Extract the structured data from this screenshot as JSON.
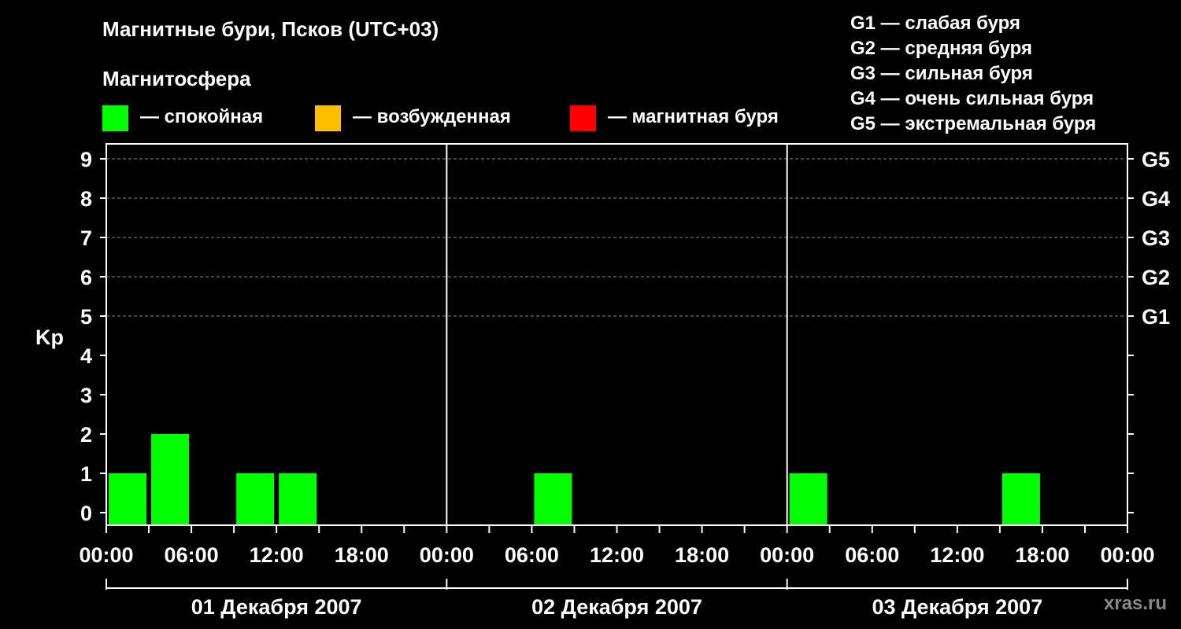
{
  "title": "Магнитные бури, Псков (UTC+03)",
  "subtitle": "Магнитосфера",
  "legend": [
    {
      "label": "— спокойная",
      "color": "#00ff00"
    },
    {
      "label": "— возбужденная",
      "color": "#ffbf00"
    },
    {
      "label": "— магнитная буря",
      "color": "#ff0000"
    }
  ],
  "g_legend": [
    "G1 — слабая буря",
    "G2 — средняя буря",
    "G3 — сильная буря",
    "G4 — очень сильная буря",
    "G5 — экстремальная буря"
  ],
  "watermark": "xras.ru",
  "chart_data": {
    "type": "bar",
    "ylabel": "Kp",
    "ylim": [
      0,
      9
    ],
    "yticks": [
      "0",
      "1",
      "2",
      "3",
      "4",
      "5",
      "6",
      "7",
      "8",
      "9"
    ],
    "right_labels": [
      {
        "kp": 5,
        "label": "G1"
      },
      {
        "kp": 6,
        "label": "G2"
      },
      {
        "kp": 7,
        "label": "G3"
      },
      {
        "kp": 8,
        "label": "G4"
      },
      {
        "kp": 9,
        "label": "G5"
      }
    ],
    "grid": "dashed horizontal at Kp 5–9",
    "x_tick_labels": [
      "00:00",
      "06:00",
      "12:00",
      "18:00",
      "00:00",
      "06:00",
      "12:00",
      "18:00",
      "00:00",
      "06:00",
      "12:00",
      "18:00",
      "00:00"
    ],
    "days": [
      "01 Декабря 2007",
      "02 Декабря 2007",
      "03 Декабря 2007"
    ],
    "series": [
      {
        "color": "#00ff00",
        "x": [
          "01.12.2007 00:00",
          "01.12.2007 03:00",
          "01.12.2007 09:00",
          "01.12.2007 12:00",
          "02.12.2007 06:00",
          "03.12.2007 00:00",
          "03.12.2007 15:00"
        ],
        "values": [
          1,
          2,
          1,
          1,
          1,
          1,
          1
        ]
      }
    ]
  }
}
